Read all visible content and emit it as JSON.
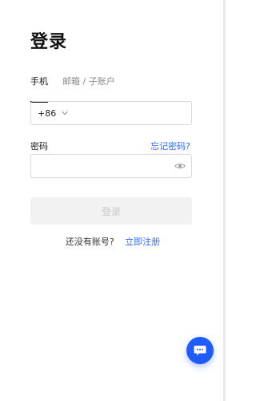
{
  "page": {
    "title": "登录"
  },
  "tabs": [
    {
      "label": "手机",
      "active": true
    },
    {
      "label": "邮箱 / 子账户",
      "active": false
    }
  ],
  "phone": {
    "country_code": "+86",
    "value": "",
    "placeholder": ""
  },
  "password": {
    "label": "密码",
    "forgot": "忘记密码?",
    "value": "",
    "placeholder": ""
  },
  "actions": {
    "login": "登录"
  },
  "register": {
    "question": "还没有账号?",
    "link": "立即注册"
  },
  "icons": {
    "country_dropdown": "chevron-down-icon",
    "password_visibility": "eye-icon",
    "chat": "chat-bubble-icon"
  },
  "colors": {
    "accent": "#2F6BFF",
    "fab": "#1F5BFF",
    "disabled_button_bg": "#F2F2F2",
    "disabled_button_text": "#C9C9C9"
  }
}
